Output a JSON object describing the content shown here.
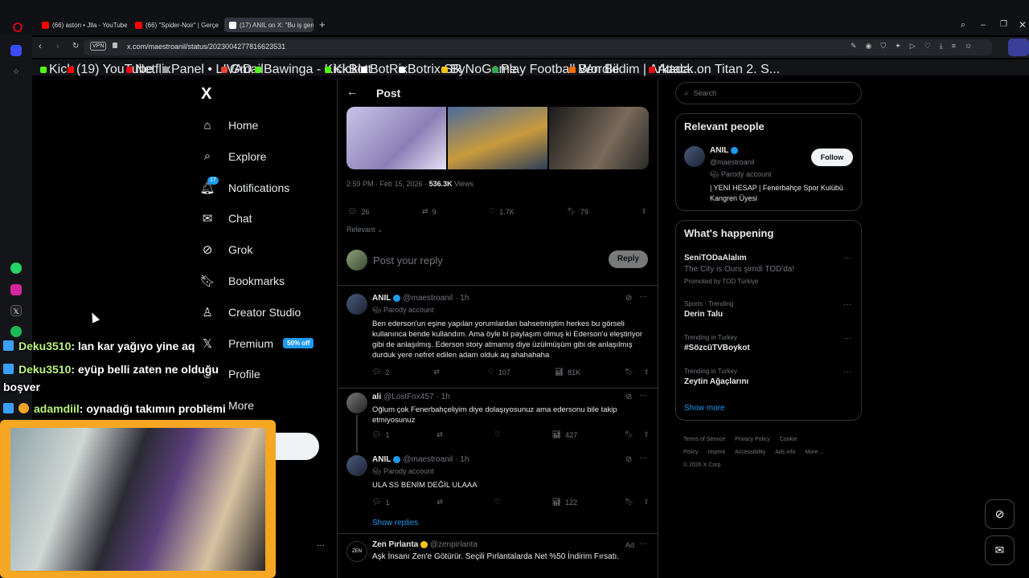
{
  "browser": {
    "tabs": [
      {
        "label": "(66) aston • Jlla - YouTube",
        "color": "#ff0000",
        "active": false
      },
      {
        "label": "(66) \"Spider-Noir\" | Gerçe",
        "color": "#ff0000",
        "active": false
      },
      {
        "label": "(17) ANIL on X: \"Bu iş gerç",
        "color": "#ffffff",
        "active": true
      }
    ],
    "vpn_label": "VPN",
    "url": "x.com/maestroanil/status/2023004277816623531",
    "bookmarks": [
      {
        "label": "Kick",
        "color": "#53fc18"
      },
      {
        "label": "(19) YouTube",
        "color": "#ff0000"
      },
      {
        "label": "Netflix",
        "color": "#e50914"
      },
      {
        "label": "Panel • LIVAD",
        "color": "#9aa0a6"
      },
      {
        "label": "Gmail",
        "color": "#ea4335"
      },
      {
        "label": "Bawinga - KickBot",
        "color": "#53fc18"
      },
      {
        "label": "Kicklet",
        "color": "#53fc18"
      },
      {
        "label": "BotRix",
        "color": "#ffffff"
      },
      {
        "label": "Botrix SR",
        "color": "#ffffff"
      },
      {
        "label": "ByNoGame",
        "color": "#f5c518"
      },
      {
        "label": "Play Football Wordle",
        "color": "#34a853"
      },
      {
        "label": "Ben Bildim | Arkada...",
        "color": "#ff6d00"
      },
      {
        "label": "Attack on Titan 2. S...",
        "color": "#e50914"
      }
    ]
  },
  "sidebar": {
    "logo": "X",
    "items": [
      {
        "label": "Home",
        "icon": "home-icon"
      },
      {
        "label": "Explore",
        "icon": "search-icon"
      },
      {
        "label": "Notifications",
        "icon": "bell-icon",
        "count": "17"
      },
      {
        "label": "Chat",
        "icon": "mail-icon"
      },
      {
        "label": "Grok",
        "icon": "grok-icon"
      },
      {
        "label": "Bookmarks",
        "icon": "bookmark-icon"
      },
      {
        "label": "Creator Studio",
        "icon": "creator-icon"
      },
      {
        "label": "Premium",
        "icon": "x-icon",
        "badge": "50% off"
      },
      {
        "label": "Profile",
        "icon": "profile-icon"
      },
      {
        "label": "More",
        "icon": "more-icon"
      }
    ]
  },
  "post": {
    "header_title": "Post",
    "timestamp": "2:59 PM · Feb 15, 2026 · ",
    "views_count": "536.3K",
    "views_label": " Views",
    "stats": {
      "replies": "26",
      "reposts": "9",
      "likes": "1.7K",
      "bookmarks": "79"
    },
    "sort_label": "Relevant",
    "reply_placeholder": "Post your reply",
    "reply_button": "Reply"
  },
  "replies": [
    {
      "name": "ANIL",
      "handle": "@maestroanil",
      "time": "· 1h",
      "parody": "Parody account",
      "text": "Ben ederson'un eşine yapılan yorumlardan bahsetmiştim herkes bu görseli kullanınca bende kullandım. Ama öyle bi paylaşım olmuş ki Ederson'u eleştiriyor gibi de anlaşılmış. Ederson story atmamış diye üzülmüşüm gibi de anlaşılmış durduk yere nefret edilen adam olduk aq ahahahaha",
      "replies": "2",
      "reposts": "",
      "likes": "107",
      "views": "81K"
    },
    {
      "name": "ali",
      "handle": "@LostFox457",
      "time": "· 1h",
      "parody": "",
      "text": "Oğlum çok Fenerbahçeliyim diye dolaşıyosunuz ama edersonu bile takip etmiyosunuz",
      "replies": "1",
      "reposts": "",
      "likes": "",
      "views": "427"
    },
    {
      "name": "ANIL",
      "handle": "@maestroanil",
      "time": "· 1h",
      "parody": "Parody account",
      "text": "ULA SS BENİM DEĞİL ULAAA",
      "replies": "1",
      "reposts": "",
      "likes": "",
      "views": "122"
    }
  ],
  "show_replies": "Show replies",
  "ad": {
    "name": "Zen Pırlanta",
    "handle": "@zenpirlanta",
    "ad_label": "Ad",
    "avatar_text": "ZEN",
    "text": "Aşk İnsanı Zen'e Götürür. Seçili Pırlantalarda Net %50 İndirim Fırsatı."
  },
  "right": {
    "search_placeholder": "Search",
    "relevant_title": "Relevant people",
    "person": {
      "name": "ANIL",
      "handle": "@maestroanil",
      "parody": "Parody account",
      "bio": "| YENİ HESAP | Fenerbahçe Spor Kulübü Kangren Üyesi",
      "follow": "Follow"
    },
    "happening_title": "What's happening",
    "trends": [
      {
        "label": "",
        "title": "SeniTODaAlalım",
        "sub": "The City is Ours şimdi TOD'da!",
        "promo": "Promoted by TOD Türkiye"
      },
      {
        "label": "Sports · Trending",
        "title": "Derin Talu",
        "sub": "",
        "promo": ""
      },
      {
        "label": "Trending in Turkey",
        "title": "#SözcüTVBoykot",
        "sub": "",
        "promo": ""
      },
      {
        "label": "Trending in Turkey",
        "title": "Zeytin Ağaçlarını",
        "sub": "",
        "promo": ""
      }
    ],
    "show_more": "Show more",
    "footer_links": [
      "Terms of Service",
      "Privacy Policy",
      "Cookie Policy",
      "Imprint",
      "Accessibility",
      "Ads info",
      "More ..."
    ],
    "copyright": "© 2026 X Corp."
  },
  "chat_overlay": [
    {
      "user": "Deku3510",
      "text": ": lan kar yağıyo yine aq"
    },
    {
      "user": "Deku3510",
      "text": ": eyüp belli zaten ne olduğu boşver"
    },
    {
      "user": "adamdiil",
      "text": ": oynadığı takımın problemi"
    }
  ],
  "colors": {
    "accent": "#1d9bf0",
    "chat_user": "#b9f27a",
    "webcam_border": "#f5a623"
  }
}
